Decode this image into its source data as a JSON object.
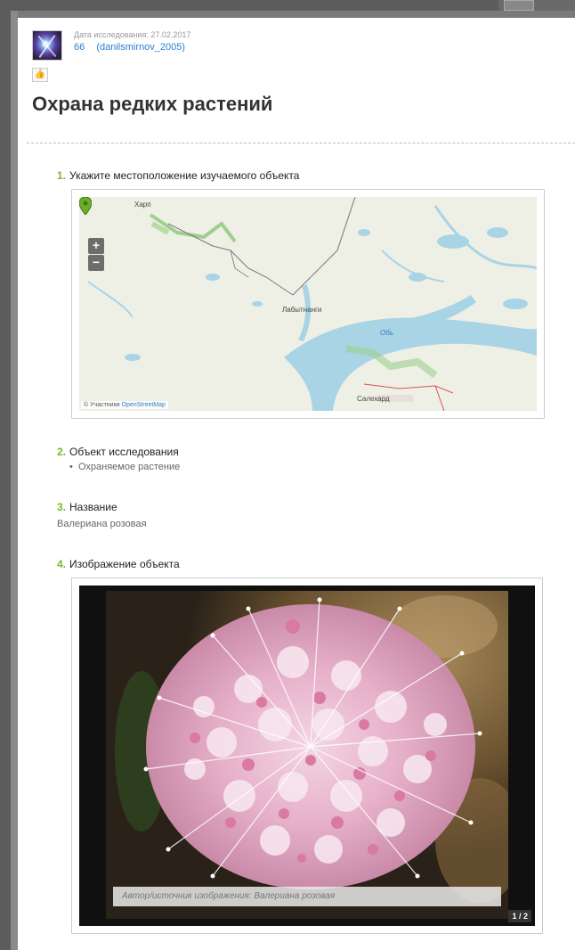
{
  "header": {
    "date_label": "Дата исследования: 27.02.2017",
    "score": "66",
    "username": "(danilsmirnov_2005)"
  },
  "page_title": "Охрана редких растений",
  "questions": [
    {
      "num": "1.",
      "title": "Укажите местоположение изучаемого объекта"
    },
    {
      "num": "2.",
      "title": "Объект исследования",
      "answer": "Охраняемое растение"
    },
    {
      "num": "3.",
      "title": "Название",
      "answer": "Валериана розовая"
    },
    {
      "num": "4.",
      "title": "Изображение объекта"
    }
  ],
  "map": {
    "zoom_in": "+",
    "zoom_out": "−",
    "labels": {
      "kharp": "Харп",
      "labytnangi": "Лабытнанги",
      "ob": "Обь",
      "salekhard": "Салехард"
    },
    "attribution_prefix": "© Участники",
    "attribution_link": "OpenStreetMap"
  },
  "image": {
    "caption_prefix": "Автор/источник изображения:",
    "caption_value": "Валериана розовая",
    "counter": "1 / 2"
  },
  "colors": {
    "accent_green": "#7ab829",
    "link_blue": "#2a7fcf",
    "water": "#a8d4e6",
    "marker": "#6cae2a"
  }
}
